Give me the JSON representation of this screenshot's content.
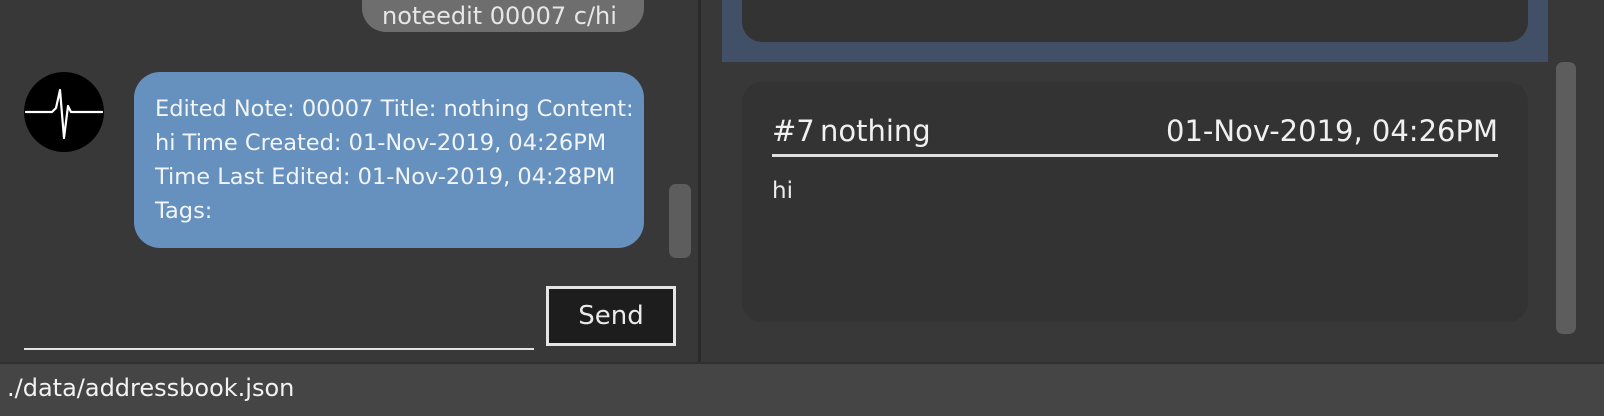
{
  "chat": {
    "previous_user_message": "noteedit 00007 c/hi",
    "bot_response_lines": [
      "Edited Note: 00007 Title: nothing Content:",
      "hi Time Created: 01-Nov-2019, 04:26PM",
      "Time Last Edited: 01-Nov-2019, 04:28PM",
      "Tags:"
    ],
    "avatar_icon": "heartbeat-pulse-icon",
    "input_value": "",
    "send_label": "Send"
  },
  "notes": {
    "selected_card_preview": "",
    "card": {
      "id": "#7",
      "title": "nothing",
      "time": "01-Nov-2019, 04:26PM",
      "content": "hi"
    }
  },
  "status_bar": {
    "path": "./data/addressbook.json"
  },
  "colors": {
    "background": "#383838",
    "bot_bubble": "#6690bd",
    "user_bubble": "#6e6e6e",
    "selected_highlight": "#425067",
    "card": "#333333"
  }
}
